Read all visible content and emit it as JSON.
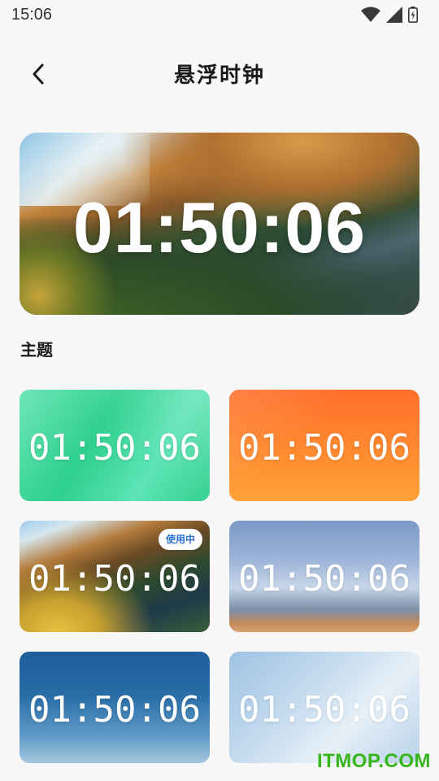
{
  "status_bar": {
    "time": "15:06",
    "icons": [
      "wifi-icon",
      "signal-icon",
      "battery-charging-icon"
    ]
  },
  "header": {
    "back_icon": "chevron-left-icon",
    "title": "悬浮时钟"
  },
  "preview": {
    "time": "01:50:06",
    "background": "mountain-landscape"
  },
  "section": {
    "title": "主题"
  },
  "themes": [
    {
      "time": "01:50:06",
      "style": "green-gradient",
      "in_use": false
    },
    {
      "time": "01:50:06",
      "style": "orange-gradient",
      "in_use": false
    },
    {
      "time": "01:50:06",
      "style": "mountain-landscape",
      "in_use": true,
      "badge": "使用中"
    },
    {
      "time": "01:50:06",
      "style": "sky-rooftop",
      "in_use": false
    },
    {
      "time": "01:50:06",
      "style": "deep-blue-gradient",
      "in_use": false
    },
    {
      "time": "01:50:06",
      "style": "frosted-light-blue",
      "in_use": false
    }
  ],
  "colors": {
    "badge_text": "#2a6fd6",
    "watermark": "#37b61c"
  },
  "watermark": "ITMOP.COM"
}
